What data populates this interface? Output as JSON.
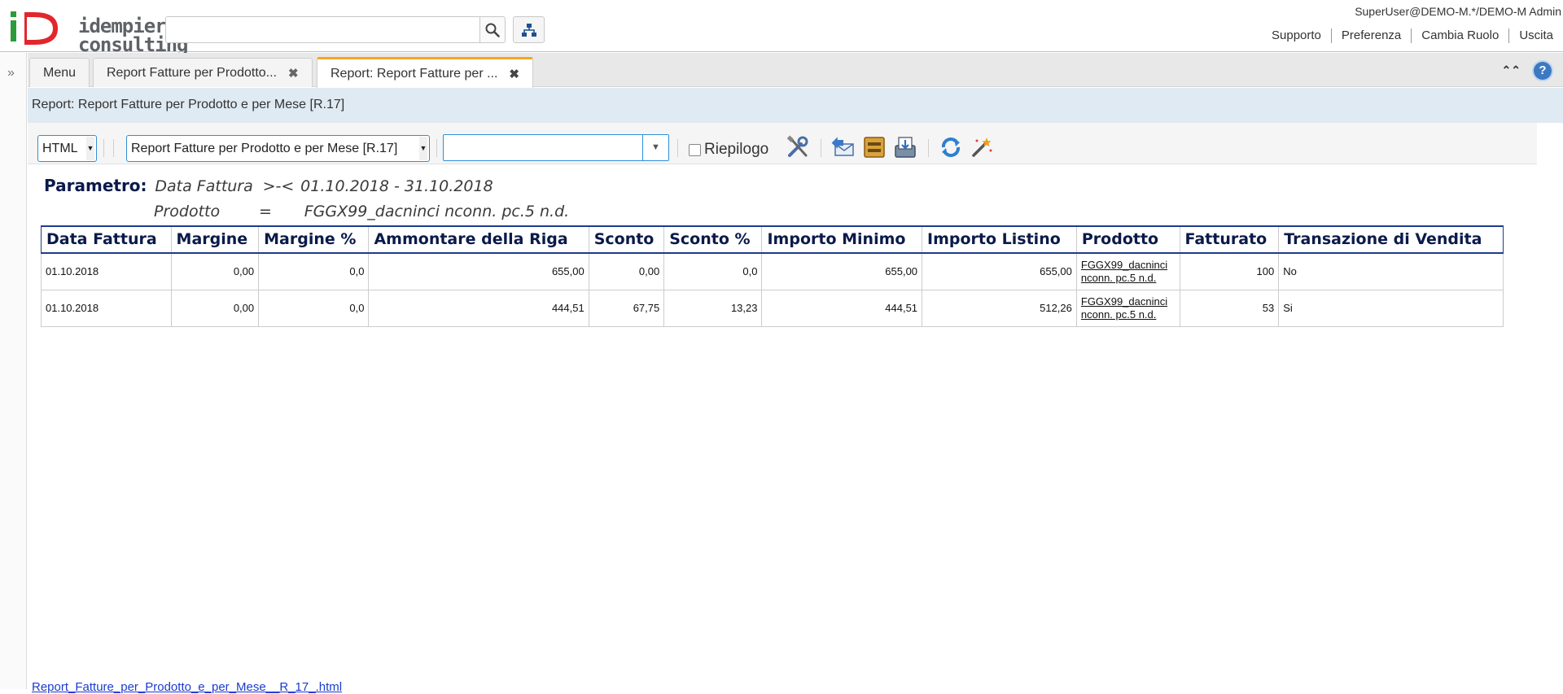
{
  "header": {
    "logo_line1": "idempiere",
    "logo_line2": "consulting",
    "search_placeholder": "",
    "user": "SuperUser@DEMO-M.*/DEMO-M Admin",
    "links": [
      "Supporto",
      "Preferenza",
      "Cambia Ruolo",
      "Uscita"
    ],
    "logo_colors": {
      "green": "#2a9d3a",
      "red": "#e2262b"
    }
  },
  "tabs": [
    {
      "label": "Menu",
      "closable": false
    },
    {
      "label": "Report Fatture per Prodotto...",
      "closable": true
    },
    {
      "label": "Report: Report Fatture per ...",
      "closable": true,
      "active": true
    }
  ],
  "help_label": "?",
  "breadcrumb": "Report: Report Fatture per Prodotto e per Mese [R.17]",
  "toolbar": {
    "format": "HTML",
    "report": "Report Fatture per Prodotto e per Mese [R.17]",
    "print_format_value": "",
    "summary_label": "Riepilogo",
    "summary_checked": false
  },
  "report": {
    "param_key": "Parametro:",
    "params": [
      {
        "name": "Data Fattura",
        "op": ">-<",
        "value": "01.10.2018 - 31.10.2018"
      },
      {
        "name": "Prodotto",
        "op": "=",
        "value": "FGGX99_dacninci nconn. pc.5 n.d."
      }
    ],
    "columns": [
      "Data Fattura",
      "Margine",
      "Margine %",
      "Ammontare della Riga",
      "Sconto",
      "Sconto %",
      "Importo Minimo",
      "Importo Listino",
      "Prodotto",
      "Fatturato",
      "Transazione di Vendita"
    ],
    "rows": [
      {
        "data_fattura": "01.10.2018",
        "margine": "0,00",
        "margine_pct": "0,0",
        "ammontare": "655,00",
        "sconto": "0,00",
        "sconto_pct": "0,0",
        "importo_minimo": "655,00",
        "importo_listino": "655,00",
        "prodotto_l1": "FGGX99_dacninci",
        "prodotto_l2": "nconn. pc.5 n.d.",
        "fatturato": "100",
        "transazione": "No"
      },
      {
        "data_fattura": "01.10.2018",
        "margine": "0,00",
        "margine_pct": "0,0",
        "ammontare": "444,51",
        "sconto": "67,75",
        "sconto_pct": "13,23",
        "importo_minimo": "444,51",
        "importo_listino": "512,26",
        "prodotto_l1": "FGGX99_dacninci",
        "prodotto_l2": "nconn. pc.5 n.d.",
        "fatturato": "53",
        "transazione": "Si"
      }
    ]
  },
  "footer_link": "Report_Fatture_per_Prodotto_e_per_Mese__R_17_.html"
}
